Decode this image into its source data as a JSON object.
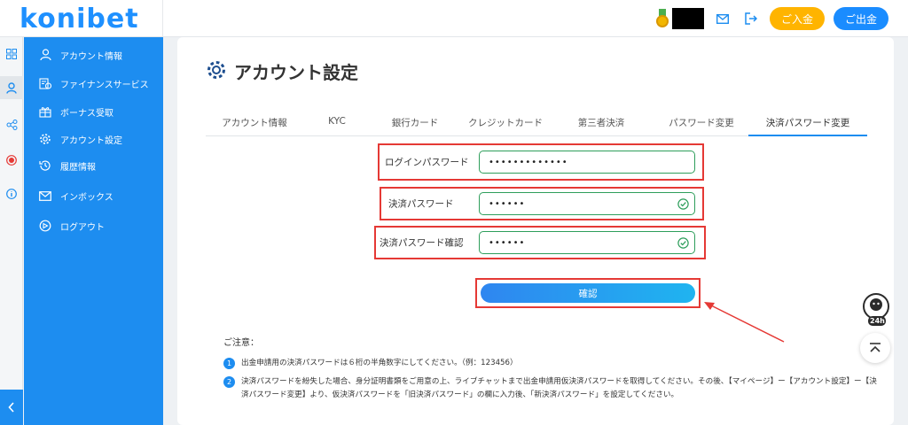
{
  "brand": {
    "logo_text": "konibet"
  },
  "header": {
    "deposit_label": "ご入金",
    "withdraw_label": "ご出金",
    "icons": [
      "medal-icon",
      "mail-icon",
      "logout-icon"
    ]
  },
  "sidebar": {
    "items": [
      {
        "label": "アカウント情報",
        "icon": "user-icon"
      },
      {
        "label": "ファイナンスサービス",
        "icon": "finance-icon"
      },
      {
        "label": "ボーナス受取",
        "icon": "bonus-icon"
      },
      {
        "label": "アカウント設定",
        "icon": "gear-icon"
      },
      {
        "label": "履歴情報",
        "icon": "history-icon"
      },
      {
        "label": "インボックス",
        "icon": "mail-icon"
      },
      {
        "label": "ログアウト",
        "icon": "logout-icon"
      }
    ]
  },
  "page": {
    "title": "アカウント設定",
    "tabs": [
      {
        "label": "アカウント情報"
      },
      {
        "label": "KYC"
      },
      {
        "label": "銀行カード"
      },
      {
        "label": "クレジットカード"
      },
      {
        "label": "第三者決済"
      },
      {
        "label": "パスワード変更"
      },
      {
        "label": "決済パスワード変更"
      }
    ],
    "active_tab": "決済パスワード変更"
  },
  "form": {
    "login_password": {
      "label": "ログインパスワード",
      "value": "•••••••••••••"
    },
    "payment_password": {
      "label": "決済パスワード",
      "value": "••••••"
    },
    "payment_password_confirm": {
      "label": "決済パスワード確認",
      "value": "••••••"
    },
    "confirm_label": "確認"
  },
  "notes": {
    "heading": "ご注意：",
    "items": [
      {
        "num": "1",
        "text": "出金申請用の決済パスワードは６桁の半角数字にしてください。（例：123456）"
      },
      {
        "num": "2",
        "text": "決済パスワードを紛失した場合、身分証明書類をご用意の上、ライブチャットまで出金申請用仮決済パスワードを取得してください。その後、【マイページ】ー【アカウント設定】ー【決済パスワード変更】より、仮決済パスワードを「旧決済パスワード」の欄に入力後、「新決済パスワード」を設定してください。"
      }
    ]
  },
  "widgets": {
    "chat_badge": "24h"
  },
  "colors": {
    "primary": "#1d8df0",
    "deposit": "#ffb400",
    "highlight": "#e53935",
    "valid": "#2e9e5b"
  }
}
